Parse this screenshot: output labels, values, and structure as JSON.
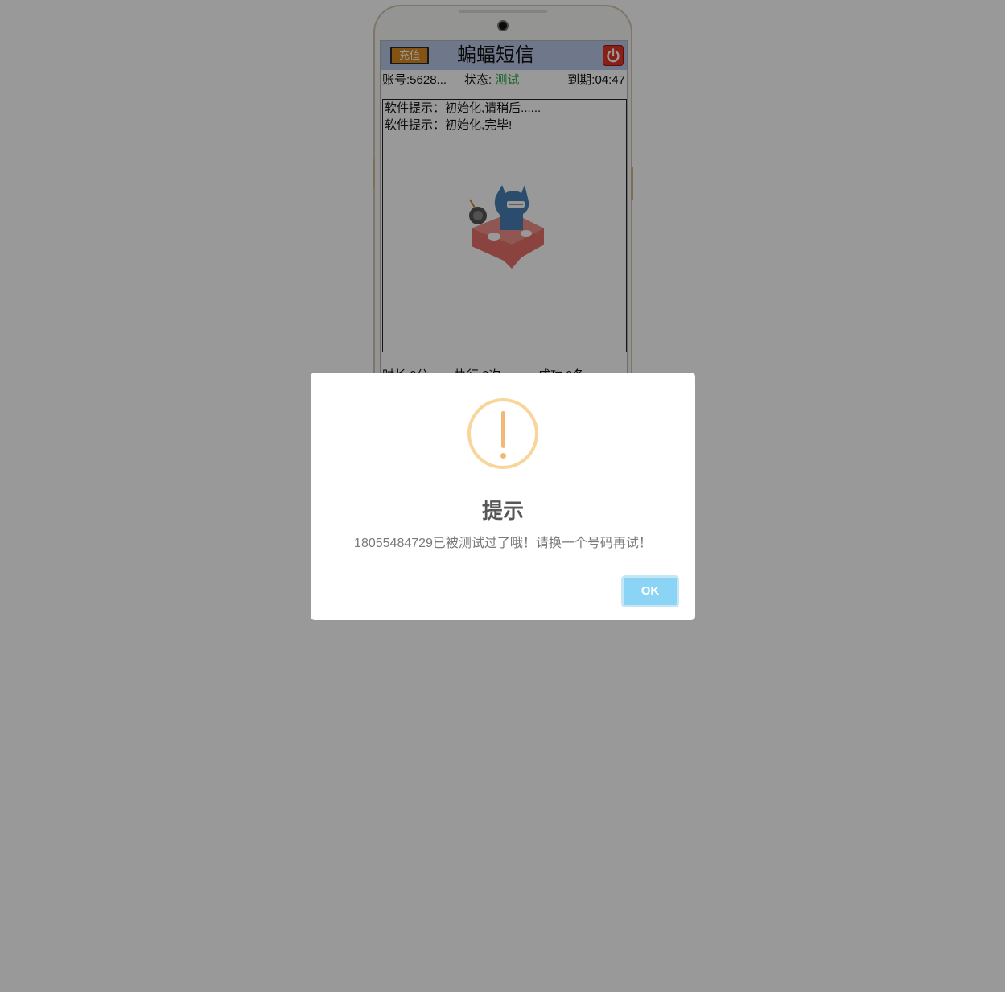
{
  "app": {
    "title": "蝙蝠短信",
    "recharge_label": "充值",
    "power_icon": "power-icon"
  },
  "info": {
    "account": "账号:5628...",
    "status_label": "状态:",
    "status_value": "测试",
    "expire": "到期:04:47"
  },
  "log": {
    "lines": [
      "软件提示：初始化,请稍后......",
      "软件提示：初始化,完毕!"
    ]
  },
  "stats": {
    "duration": "时长:0分",
    "executions": "执行:0次",
    "success": "成功:0条"
  },
  "dialog": {
    "icon": "warning-icon",
    "title": "提示",
    "message": "18055484729已被测试过了哦！请换一个号码再试！",
    "ok_label": "OK"
  },
  "colors": {
    "overlay": "#000000",
    "header_bg": "#b9c9e6",
    "recharge_bg": "#d98a1e",
    "status_green": "#33a84a",
    "warning_orange": "#f8bb86",
    "ok_button": "#8cd4f5"
  }
}
